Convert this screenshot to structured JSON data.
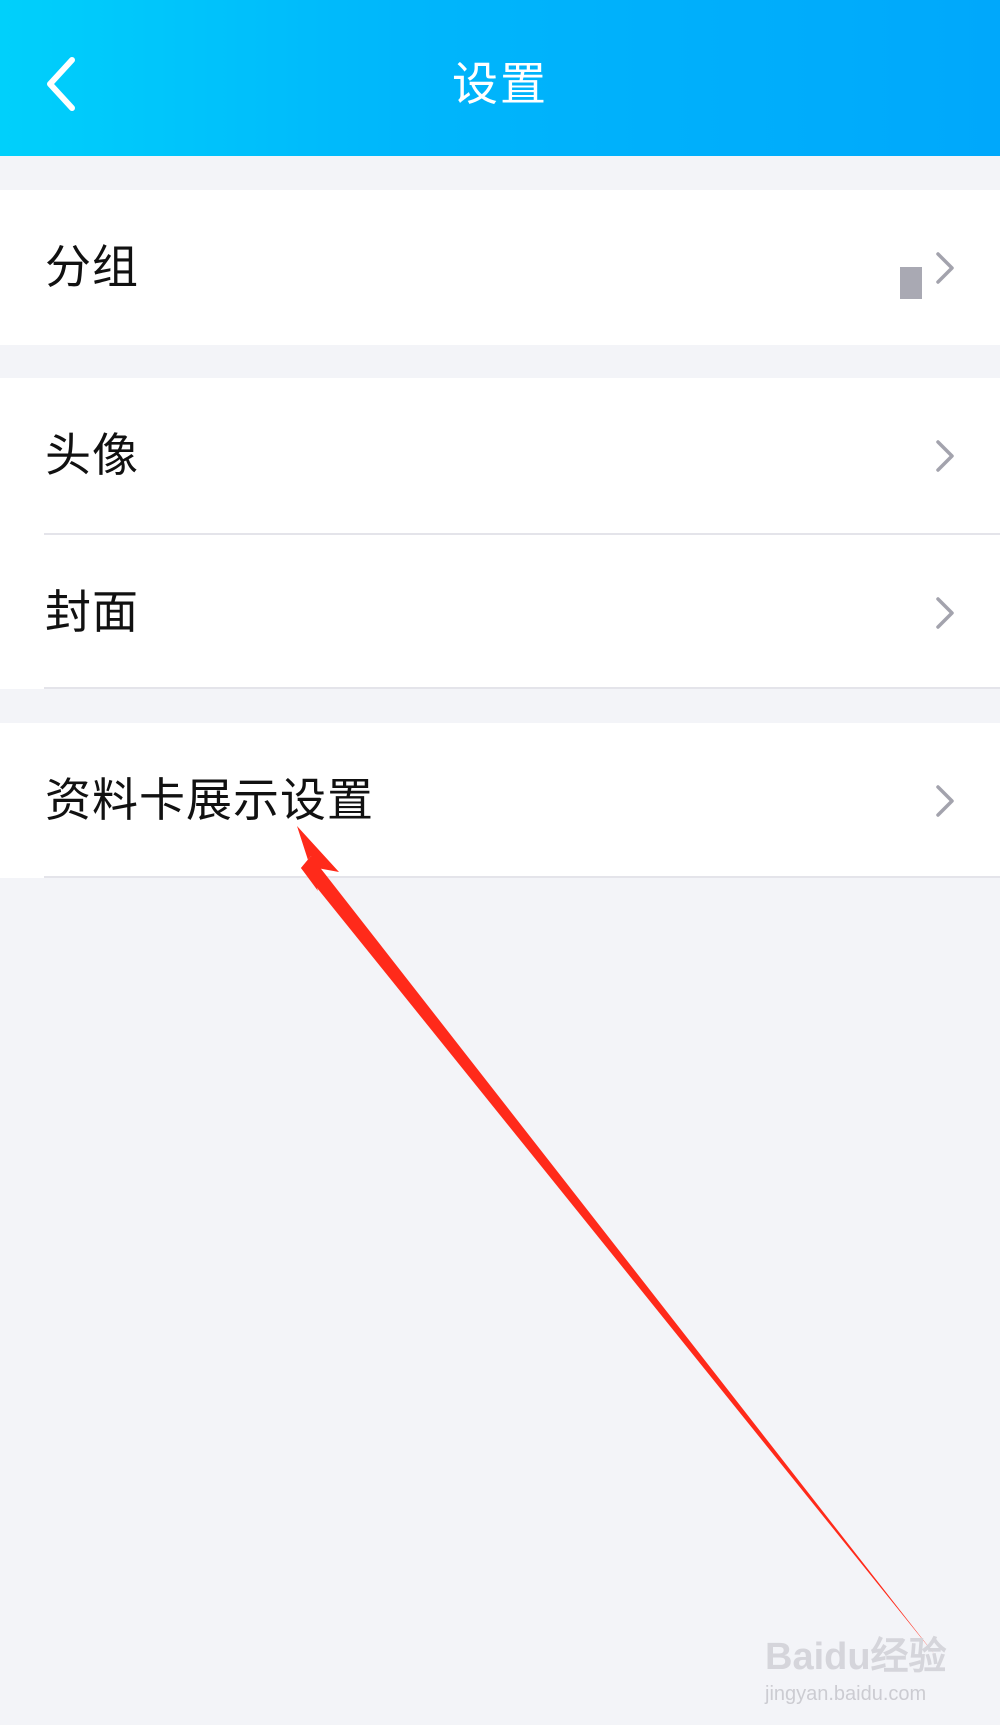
{
  "header": {
    "title": "设置",
    "back_icon": "chevron-left-icon",
    "gradient_start": "#00d0fb",
    "gradient_end": "#00a8fb"
  },
  "groups": [
    {
      "items": [
        {
          "label": "分组"
        }
      ]
    },
    {
      "items": [
        {
          "label": "头像"
        },
        {
          "label": "封面"
        }
      ]
    },
    {
      "items": [
        {
          "label": "资料卡展示设置"
        }
      ]
    }
  ],
  "row_chevron_icon": "chevron-right-icon",
  "annotation": {
    "color": "#ff2a1a",
    "description_icon": "red-arrow-icon"
  },
  "watermark": {
    "logo_text": "Baidu经验",
    "url": "jingyan.baidu.com"
  }
}
